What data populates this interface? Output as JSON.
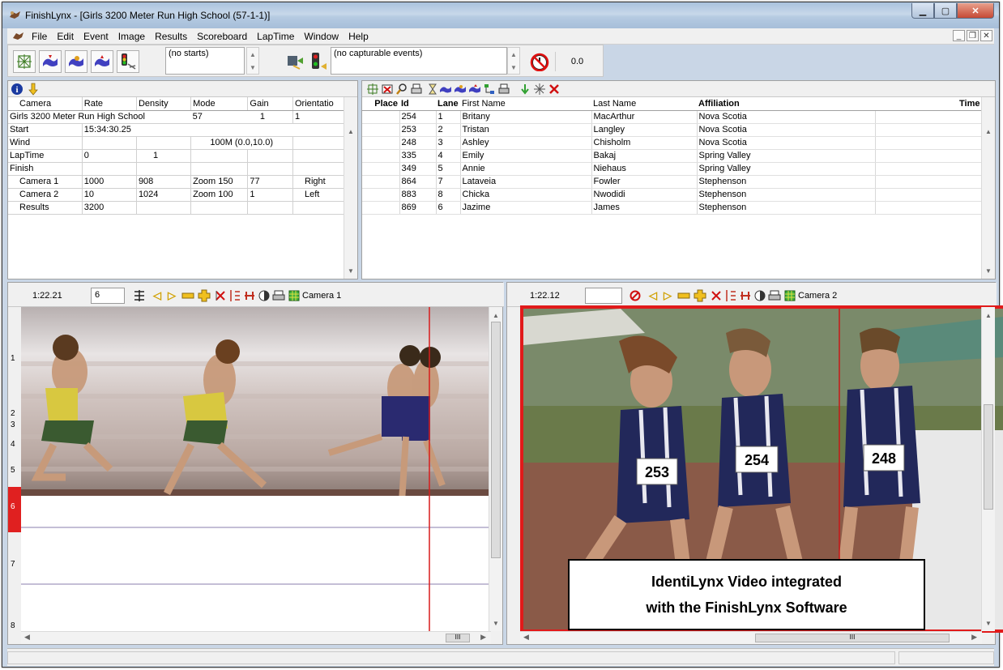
{
  "window": {
    "title": "FinishLynx - [Girls 3200 Meter Run High School (57-1-1)]"
  },
  "menu": [
    "File",
    "Edit",
    "Event",
    "Image",
    "Results",
    "Scoreboard",
    "LapTime",
    "Window",
    "Help"
  ],
  "toolbar": {
    "starts_combo": "(no starts)",
    "capture_combo": "(no capturable events)",
    "time_display": "0.0"
  },
  "event_panel": {
    "headers": [
      "Camera",
      "Rate",
      "Density",
      "Mode",
      "Gain",
      "Orientatio"
    ],
    "rows": [
      [
        "Girls 3200 Meter Run High School",
        "",
        "",
        "57",
        "1",
        "1"
      ],
      [
        "Start",
        "15:34:30.25",
        "",
        "",
        "",
        ""
      ],
      [
        "Wind",
        "",
        "",
        "100M (0.0,10.0)",
        "",
        ""
      ],
      [
        "LapTime",
        "0",
        "1",
        "",
        "",
        ""
      ],
      [
        "Finish",
        "",
        "",
        "",
        "",
        ""
      ],
      [
        "Camera 1",
        "1000",
        "908",
        "Zoom 150",
        "77",
        "Right"
      ],
      [
        "Camera 2",
        "10",
        "1024",
        "Zoom 100",
        "1",
        "Left"
      ],
      [
        "Results",
        "3200",
        "",
        "",
        "",
        ""
      ]
    ]
  },
  "results_panel": {
    "headers": [
      "Place",
      "Id",
      "Lane",
      "First Name",
      "Last Name",
      "Affiliation",
      "Time"
    ],
    "rows": [
      [
        "",
        "254",
        "1",
        "Britany",
        "MacArthur",
        "Nova Scotia",
        ""
      ],
      [
        "",
        "253",
        "2",
        "Tristan",
        "Langley",
        "Nova Scotia",
        ""
      ],
      [
        "",
        "248",
        "3",
        "Ashley",
        "Chisholm",
        "Nova Scotia",
        ""
      ],
      [
        "",
        "335",
        "4",
        "Emily",
        "Bakaj",
        "Spring Valley",
        ""
      ],
      [
        "",
        "349",
        "5",
        "Annie",
        "Niehaus",
        "Spring Valley",
        ""
      ],
      [
        "",
        "864",
        "7",
        "Lataveia",
        "Fowler",
        "Stephenson",
        ""
      ],
      [
        "",
        "883",
        "8",
        "Chicka",
        "Nwodidi",
        "Stephenson",
        ""
      ],
      [
        "",
        "869",
        "6",
        "Jazime",
        "James",
        "Stephenson",
        ""
      ]
    ]
  },
  "camera1": {
    "time": "1:22.21",
    "lane_box": "6",
    "label": "Camera 1",
    "lanes": [
      "1",
      "2",
      "3",
      "4",
      "5",
      "6",
      "7",
      "8"
    ],
    "selected_lane": "6"
  },
  "camera2": {
    "time": "1:22.12",
    "lane_box": "",
    "label": "Camera 2",
    "bibs": [
      "253",
      "254",
      "248"
    ]
  },
  "caption": {
    "line1": "IdentiLynx Video integrated",
    "line2": "with the FinishLynx Software"
  },
  "colors": {
    "highlight_red": "#e11a1a",
    "lane_selected": "#e02020",
    "title_bar": "#b6cbe2"
  }
}
